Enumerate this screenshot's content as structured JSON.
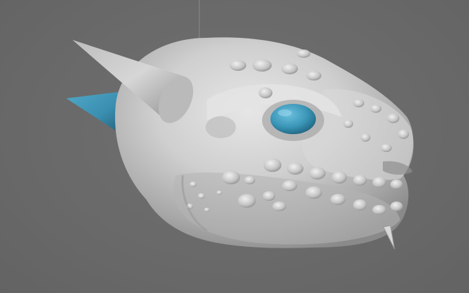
{
  "viewport": {
    "background_color": "#6b6b6b"
  },
  "model": {
    "subject": "creature-head-sculpt",
    "surface_color": "#c9c9c9",
    "accent_color": "#3a95b6",
    "parts": [
      "skull",
      "upper-horn",
      "side-horn",
      "eye",
      "snout",
      "tooth",
      "brow-ridge",
      "cheek-bumps",
      "lip-bumps"
    ]
  }
}
